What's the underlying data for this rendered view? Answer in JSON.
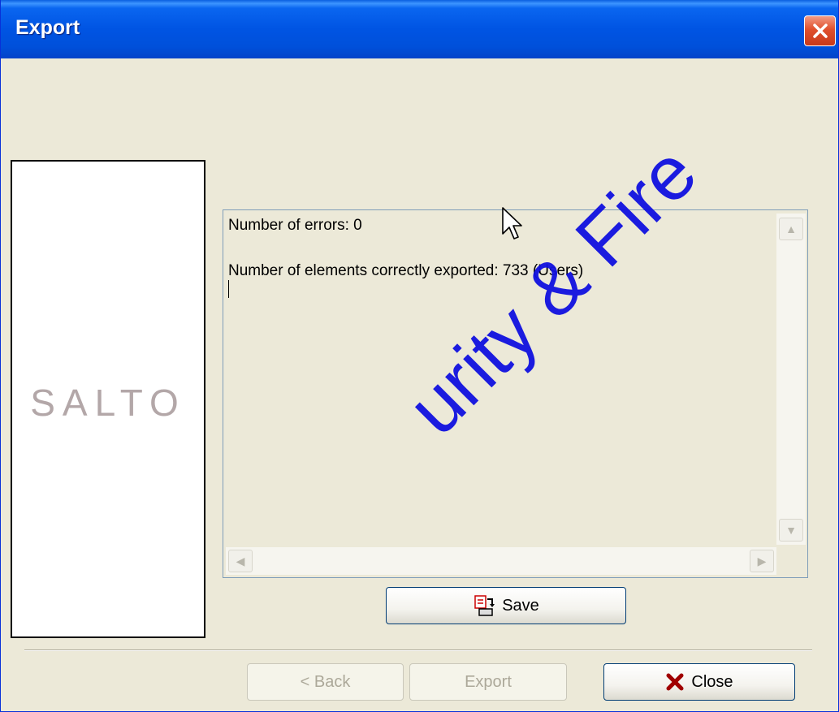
{
  "window": {
    "title": "Export"
  },
  "logo": {
    "text": "SALTO"
  },
  "output": {
    "lines": [
      "Number of errors: 0",
      "Number of elements correctly exported: 733 (Users)"
    ]
  },
  "buttons": {
    "save": "Save",
    "back": "< Back",
    "export": "Export",
    "close": "Close"
  },
  "watermark": {
    "text": "urity & Fire"
  },
  "colors": {
    "title_bar": "#0054e3",
    "dialog_bg": "#ece9d8",
    "close_button": "#e0502d",
    "watermark": "#1010e0"
  },
  "icons": [
    "close-icon",
    "save-icon",
    "close-x-icon",
    "scroll-up-icon",
    "scroll-down-icon",
    "scroll-left-icon",
    "scroll-right-icon",
    "mouse-cursor-icon"
  ]
}
